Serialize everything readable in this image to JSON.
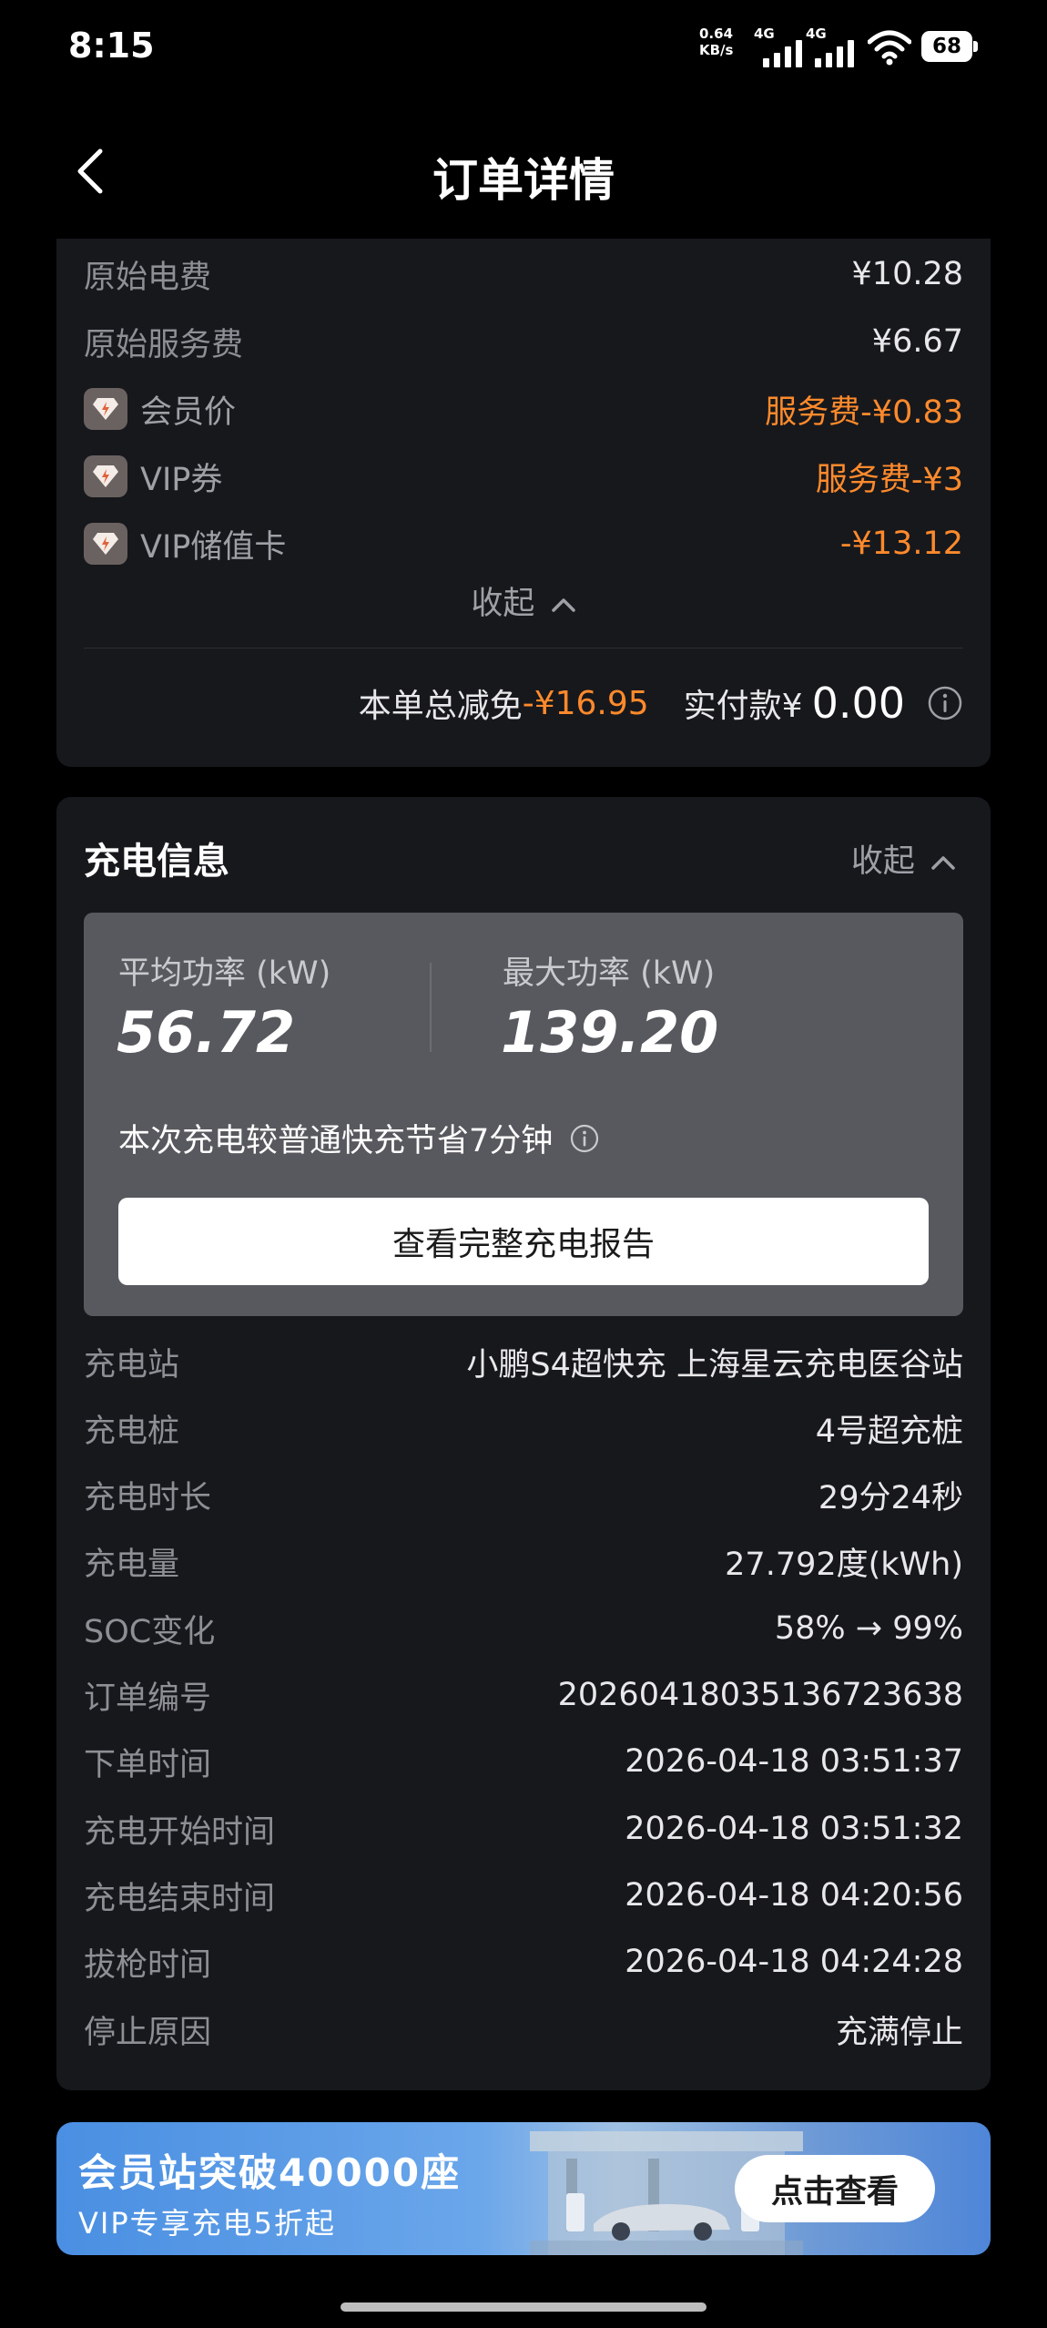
{
  "status_bar": {
    "time": "8:15",
    "net_speed_value": "0.64",
    "net_speed_unit": "KB/s",
    "signal1_tag": "4G",
    "signal2_tag": "4G",
    "battery": "68"
  },
  "header": {
    "title": "订单详情"
  },
  "price": {
    "rows": [
      {
        "label": "原始电费",
        "value": "¥10.28"
      },
      {
        "label": "原始服务费",
        "value": "¥6.67"
      },
      {
        "label": "会员价",
        "value": "服务费-¥0.83"
      },
      {
        "label": "VIP券",
        "value": "服务费-¥3"
      },
      {
        "label": "VIP储值卡",
        "value": "-¥13.12"
      }
    ],
    "collapse_label": "收起",
    "total_label": "本单总减免",
    "total_discount": "-¥16.95",
    "paid_label": "实付款¥",
    "paid_amount": "0.00"
  },
  "charge": {
    "title": "充电信息",
    "collapse_label": "收起",
    "avg_power_label": "平均功率 (kW)",
    "avg_power_value": "56.72",
    "max_power_label": "最大功率 (kW)",
    "max_power_value": "139.20",
    "save_note": "本次充电较普通快充节省7分钟",
    "report_button": "查看完整充电报告",
    "details": [
      {
        "label": "充电站",
        "value": "小鹏S4超快充 上海星云充电医谷站"
      },
      {
        "label": "充电桩",
        "value": "4号超充桩"
      },
      {
        "label": "充电时长",
        "value": "29分24秒"
      },
      {
        "label": "充电量",
        "value": "27.792度(kWh)"
      },
      {
        "label": "SOC变化",
        "value": "58% → 99%"
      },
      {
        "label": "订单编号",
        "value": "20260418035136723638"
      },
      {
        "label": "下单时间",
        "value": "2026-04-18 03:51:37"
      },
      {
        "label": "充电开始时间",
        "value": "2026-04-18 03:51:32"
      },
      {
        "label": "充电结束时间",
        "value": "2026-04-18 04:20:56"
      },
      {
        "label": "拔枪时间",
        "value": "2026-04-18 04:24:28"
      },
      {
        "label": "停止原因",
        "value": "充满停止"
      }
    ]
  },
  "banner": {
    "title": "会员站突破40000座",
    "subtitle": "VIP专享充电5折起",
    "button": "点击查看"
  },
  "colors": {
    "accent_orange": "#ff8a2c",
    "card_bg": "#17181c",
    "panel_bg": "#58595e"
  }
}
